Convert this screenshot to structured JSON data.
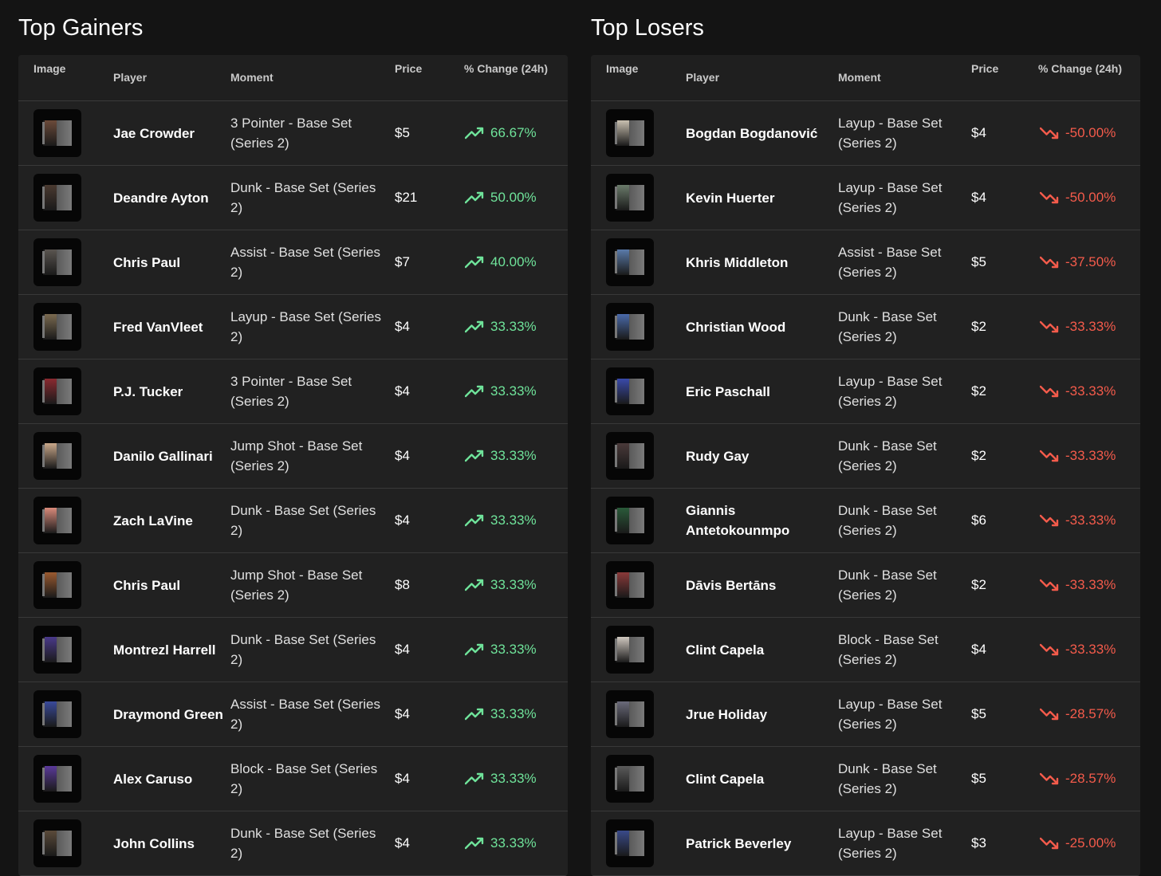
{
  "colors": {
    "up": "#6fe39a",
    "down": "#f45b4b",
    "background": "#141414",
    "table": "#212121"
  },
  "gainers": {
    "title": "Top Gainers",
    "headers": {
      "image": "Image",
      "player": "Player",
      "moment": "Moment",
      "price": "Price",
      "change": "% Change (24h)"
    },
    "trend_icon": "trending-up-icon",
    "rows": [
      {
        "player": "Jae Crowder",
        "moment": "3 Pointer - Base Set (Series 2)",
        "price": "$5",
        "change": "66.67%",
        "thumb_accent": "#6b4a3a"
      },
      {
        "player": "Deandre Ayton",
        "moment": "Dunk - Base Set (Series 2)",
        "price": "$21",
        "change": "50.00%",
        "thumb_accent": "#4a3a30"
      },
      {
        "player": "Chris Paul",
        "moment": "Assist - Base Set (Series 2)",
        "price": "$7",
        "change": "40.00%",
        "thumb_accent": "#5a5550"
      },
      {
        "player": "Fred VanVleet",
        "moment": "Layup - Base Set (Series 2)",
        "price": "$4",
        "change": "33.33%",
        "thumb_accent": "#7a6a50"
      },
      {
        "player": "P.J. Tucker",
        "moment": "3 Pointer - Base Set (Series 2)",
        "price": "$4",
        "change": "33.33%",
        "thumb_accent": "#8a2a30"
      },
      {
        "player": "Danilo Gallinari",
        "moment": "Jump Shot - Base Set (Series 2)",
        "price": "$4",
        "change": "33.33%",
        "thumb_accent": "#c9a88a"
      },
      {
        "player": "Zach LaVine",
        "moment": "Dunk - Base Set (Series 2)",
        "price": "$4",
        "change": "33.33%",
        "thumb_accent": "#d98a7a"
      },
      {
        "player": "Chris Paul",
        "moment": "Jump Shot - Base Set (Series 2)",
        "price": "$8",
        "change": "33.33%",
        "thumb_accent": "#9a5a30"
      },
      {
        "player": "Montrezl Harrell",
        "moment": "Dunk - Base Set (Series 2)",
        "price": "$4",
        "change": "33.33%",
        "thumb_accent": "#4a3a8a"
      },
      {
        "player": "Draymond Green",
        "moment": "Assist - Base Set (Series 2)",
        "price": "$4",
        "change": "33.33%",
        "thumb_accent": "#3a4a9a"
      },
      {
        "player": "Alex Caruso",
        "moment": "Block - Base Set (Series 2)",
        "price": "$4",
        "change": "33.33%",
        "thumb_accent": "#5a3a9a"
      },
      {
        "player": "John Collins",
        "moment": "Dunk - Base Set (Series 2)",
        "price": "$4",
        "change": "33.33%",
        "thumb_accent": "#5a4a3a"
      }
    ]
  },
  "losers": {
    "title": "Top Losers",
    "headers": {
      "image": "Image",
      "player": "Player",
      "moment": "Moment",
      "price": "Price",
      "change": "% Change (24h)"
    },
    "trend_icon": "trending-down-icon",
    "rows": [
      {
        "player": "Bogdan Bogdanović",
        "moment": "Layup - Base Set (Series 2)",
        "price": "$4",
        "change": "-50.00%",
        "thumb_accent": "#c9c0b0"
      },
      {
        "player": "Kevin Huerter",
        "moment": "Layup - Base Set (Series 2)",
        "price": "$4",
        "change": "-50.00%",
        "thumb_accent": "#6a7a6a"
      },
      {
        "player": "Khris Middleton",
        "moment": "Assist - Base Set (Series 2)",
        "price": "$5",
        "change": "-37.50%",
        "thumb_accent": "#5a7aaa"
      },
      {
        "player": "Christian Wood",
        "moment": "Dunk - Base Set (Series 2)",
        "price": "$2",
        "change": "-33.33%",
        "thumb_accent": "#4a6aaa"
      },
      {
        "player": "Eric Paschall",
        "moment": "Layup - Base Set (Series 2)",
        "price": "$2",
        "change": "-33.33%",
        "thumb_accent": "#3a4aaa"
      },
      {
        "player": "Rudy Gay",
        "moment": "Dunk - Base Set (Series 2)",
        "price": "$2",
        "change": "-33.33%",
        "thumb_accent": "#4a3a3a"
      },
      {
        "player": "Giannis Antetokounmpo",
        "moment": "Dunk - Base Set (Series 2)",
        "price": "$6",
        "change": "-33.33%",
        "thumb_accent": "#2a5a3a"
      },
      {
        "player": "Dāvis Bertāns",
        "moment": "Dunk - Base Set (Series 2)",
        "price": "$2",
        "change": "-33.33%",
        "thumb_accent": "#8a3a3a"
      },
      {
        "player": "Clint Capela",
        "moment": "Block - Base Set (Series 2)",
        "price": "$4",
        "change": "-33.33%",
        "thumb_accent": "#d0c8c0"
      },
      {
        "player": "Jrue Holiday",
        "moment": "Layup - Base Set (Series 2)",
        "price": "$5",
        "change": "-28.57%",
        "thumb_accent": "#6a6a7a"
      },
      {
        "player": "Clint Capela",
        "moment": "Dunk - Base Set (Series 2)",
        "price": "$5",
        "change": "-28.57%",
        "thumb_accent": "#5a5a5a"
      },
      {
        "player": "Patrick Beverley",
        "moment": "Layup - Base Set (Series 2)",
        "price": "$3",
        "change": "-25.00%",
        "thumb_accent": "#3a4a8a"
      }
    ]
  }
}
